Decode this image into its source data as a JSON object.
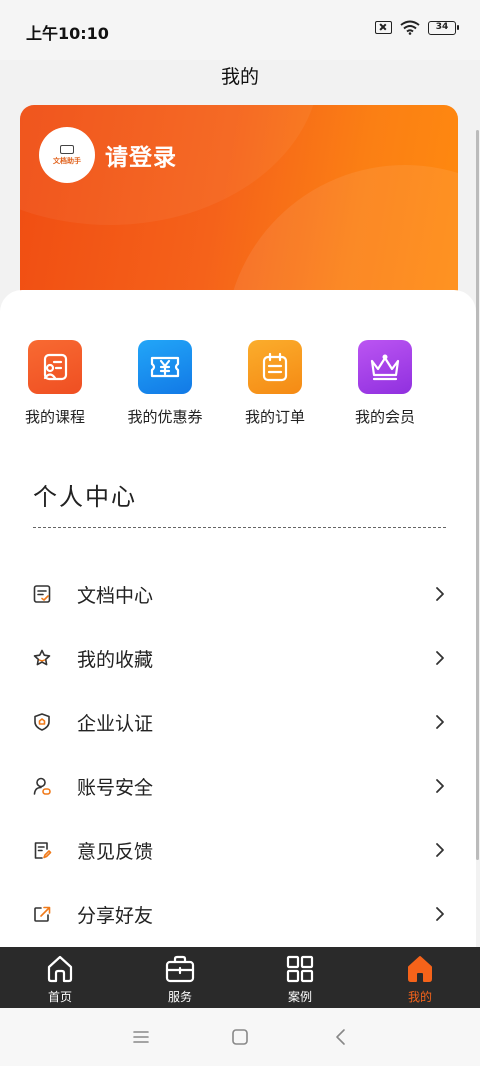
{
  "status_bar": {
    "time": "上午10:10",
    "battery": "34"
  },
  "header": {
    "title": "我的"
  },
  "profile": {
    "logo_text": "文档助手",
    "login_label": "请登录"
  },
  "quick_actions": [
    {
      "label": "我的课程",
      "icon": "course-icon",
      "color": "#f4622a"
    },
    {
      "label": "我的优惠券",
      "icon": "coupon-icon",
      "color": "#1a8cf0"
    },
    {
      "label": "我的订单",
      "icon": "order-icon",
      "color": "#f79a1a"
    },
    {
      "label": "我的会员",
      "icon": "crown-icon",
      "color": "#a742e8"
    }
  ],
  "personal_center": {
    "title": "个人中心",
    "items": [
      {
        "label": "文档中心",
        "icon": "document-check-icon"
      },
      {
        "label": "我的收藏",
        "icon": "star-icon"
      },
      {
        "label": "企业认证",
        "icon": "shield-icon"
      },
      {
        "label": "账号安全",
        "icon": "user-lock-icon"
      },
      {
        "label": "意见反馈",
        "icon": "feedback-icon"
      },
      {
        "label": "分享好友",
        "icon": "share-icon"
      }
    ]
  },
  "tabbar": {
    "items": [
      {
        "label": "首页",
        "icon": "home-icon",
        "active": false
      },
      {
        "label": "服务",
        "icon": "briefcase-icon",
        "active": false
      },
      {
        "label": "案例",
        "icon": "grid-icon",
        "active": false
      },
      {
        "label": "我的",
        "icon": "home-filled-icon",
        "active": true
      }
    ],
    "active_color": "#f5631a"
  }
}
